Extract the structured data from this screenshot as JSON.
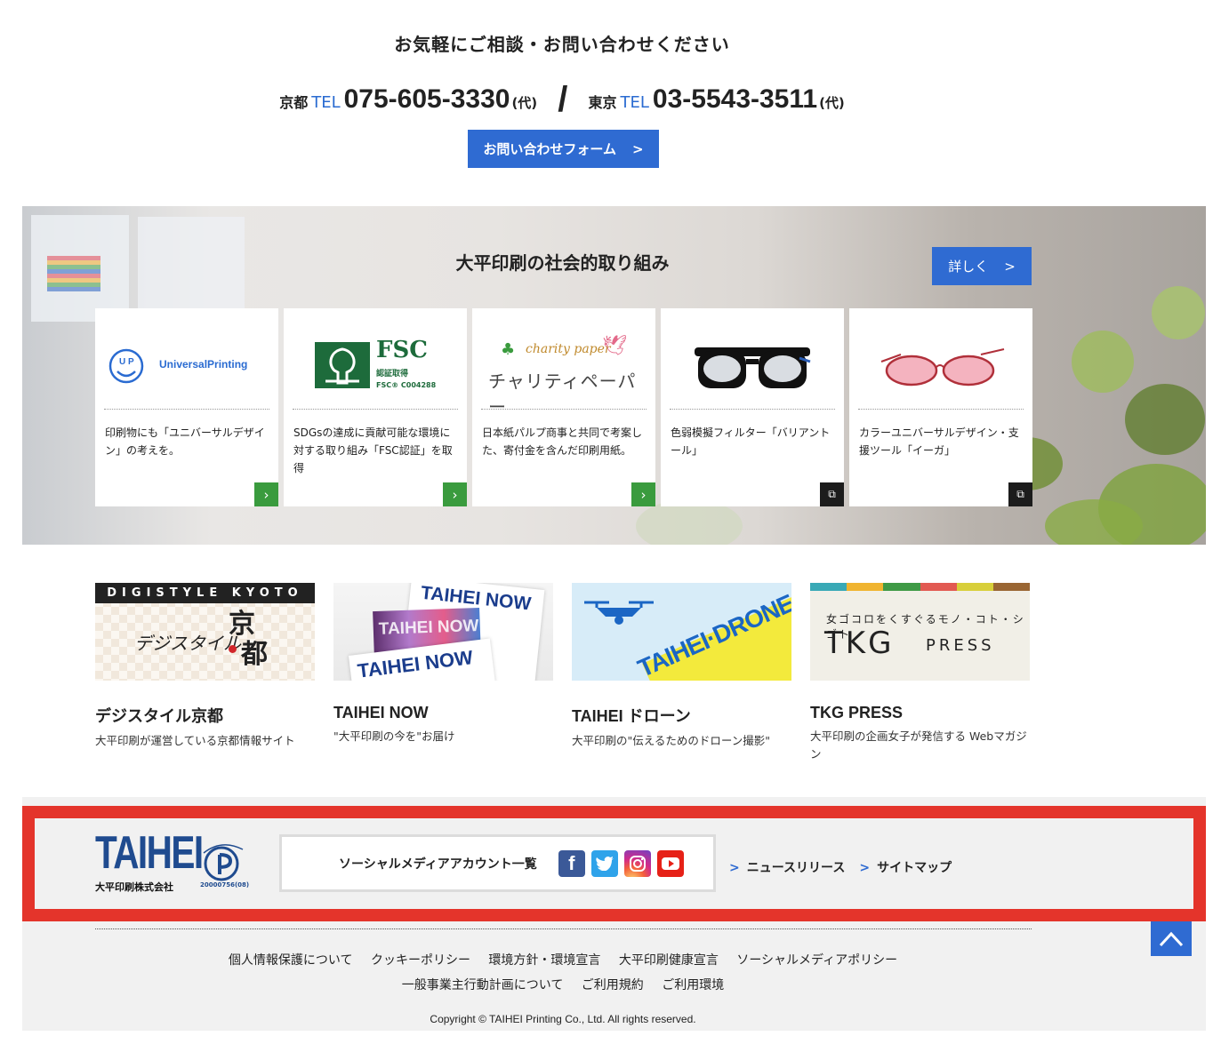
{
  "contact": {
    "heading": "お気軽にご相談・お問い合わせください",
    "kyoto_label": "京都",
    "tokyo_label": "東京",
    "tel_label": "TEL",
    "kyoto_number": "075-605-3330",
    "tokyo_number": "03-5543-3511",
    "dai": "(代)",
    "slash": "/",
    "form_button": "お問い合わせフォーム",
    "chevron": ">"
  },
  "social_section": {
    "title": "大平印刷の社会的取り組み",
    "detail_button": "詳しく",
    "cards": [
      {
        "logo": "UniversalPrinting",
        "desc": "印刷物にも「ユニバーサルデザイン」の考えを。",
        "link": "arrow-right"
      },
      {
        "logo": "FSC",
        "logo_sub": "認証取得",
        "logo_code": "FSC® C004288",
        "desc": "SDGsの達成に貢献可能な環境に対する取り組み「FSC認証」を取得",
        "link": "arrow-right"
      },
      {
        "logo": "charity paper",
        "logo_jp": "チャリティペーパー",
        "desc": "日本紙パルプ商事と共同で考案した、寄付金を含んだ印刷用紙。",
        "link": "arrow-right"
      },
      {
        "logo": "glasses-black",
        "desc": "色弱模擬フィルター「バリアントール」",
        "link": "external-window"
      },
      {
        "logo": "glasses-red",
        "desc": "カラーユニバーサルデザイン・支援ツール「イーガ」",
        "link": "external-window"
      }
    ]
  },
  "media": [
    {
      "title": "デジスタイル京都",
      "sub": "大平印刷が運営している京都情報サイト",
      "img_text": "DIGISTYLE KYOTO",
      "img_jp": "デジスタイル",
      "img_kyo": "京",
      "img_to": "都"
    },
    {
      "title": "TAIHEI NOW",
      "sub": "\"大平印刷の今を\"お届け",
      "img_text": "TAIHEI NOW"
    },
    {
      "title": "TAIHEI ドローン",
      "sub": "大平印刷の\"伝えるためのドローン撮影\"",
      "img_text": "TAIHEI·DRONE"
    },
    {
      "title": "TKG PRESS",
      "sub": "大平印刷の企画女子が発信する Webマガジン",
      "img_tag": "女ゴコロをくすぐるモノ・コト・シゴト",
      "img_tkg": "TKG",
      "img_press": "PRESS"
    }
  ],
  "footer": {
    "logo_text": "TAIHEI",
    "logo_sub": "大平印刷株式会社",
    "privacy_mark_number": "20000756(08)",
    "social_label": "ソーシャルメディアアカウント一覧",
    "social_icons": [
      "facebook-icon",
      "twitter-icon",
      "instagram-icon",
      "youtube-icon"
    ],
    "links": [
      "ニュースリリース",
      "サイトマップ"
    ],
    "policy_row1": [
      "個人情報保護について",
      "クッキーポリシー",
      "環境方針・環境宣言",
      "大平印刷健康宣言",
      "ソーシャルメディアポリシー"
    ],
    "policy_row2": [
      "一般事業主行動計画について",
      "ご利用規約",
      "ご利用環境"
    ],
    "copyright": "Copyright © TAIHEI Printing Co., Ltd. All rights reserved."
  },
  "colors": {
    "accent": "#2f6bd2",
    "highlight_frame": "#e4342b",
    "green_arrow": "#3a9b3e"
  }
}
